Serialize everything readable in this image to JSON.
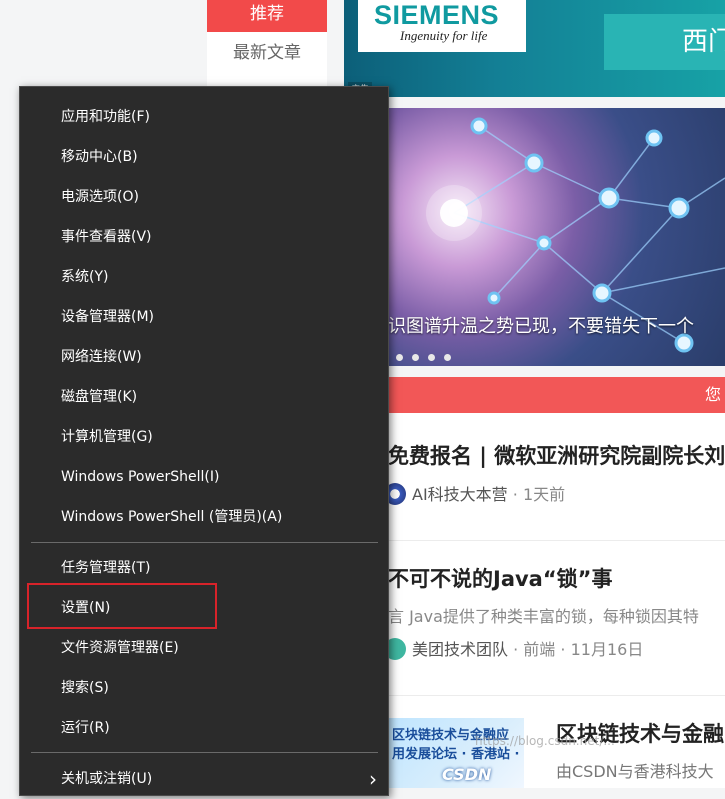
{
  "page": {
    "tab_recommend": "推荐",
    "tab_latest": "最新文章",
    "banner": {
      "brand": "SIEMENS",
      "tagline": "Ingenuity for life",
      "right_text": "西门",
      "ad_tag": "广告"
    },
    "hero": {
      "caption": "识图谱升温之势已现，不要错失下一个",
      "dots": 4
    },
    "red_bar_text": "您",
    "feed": [
      {
        "title": "免费报名 | 微软亚洲研究院副院长刘",
        "author": "AI科技大本营",
        "time": "1天前"
      },
      {
        "title": "不可不说的Java“锁”事",
        "desc": "言 Java提供了种类丰富的锁，每种锁因其特",
        "author": "美团技术团队",
        "category": "前端",
        "time": "11月16日"
      },
      {
        "title": "区块链技术与金融",
        "desc": "由CSDN与香港科技大",
        "thumb_line1": "区块链技术与金融应",
        "thumb_line2": "用发展论坛 · 香港站 ·",
        "thumb_logo": "CSDN"
      }
    ],
    "meta_separator": "·",
    "watermark": "https://blog.csdn.net/..."
  },
  "menu": {
    "items": [
      {
        "label": "应用和功能(F)"
      },
      {
        "label": "移动中心(B)"
      },
      {
        "label": "电源选项(O)"
      },
      {
        "label": "事件查看器(V)"
      },
      {
        "label": "系统(Y)"
      },
      {
        "label": "设备管理器(M)"
      },
      {
        "label": "网络连接(W)"
      },
      {
        "label": "磁盘管理(K)"
      },
      {
        "label": "计算机管理(G)"
      },
      {
        "label": "Windows PowerShell(I)"
      },
      {
        "label": "Windows PowerShell (管理员)(A)"
      },
      {
        "label": "任务管理器(T)"
      },
      {
        "label": "设置(N)",
        "highlighted": true
      },
      {
        "label": "文件资源管理器(E)"
      },
      {
        "label": "搜索(S)"
      },
      {
        "label": "运行(R)"
      },
      {
        "label": "关机或注销(U)",
        "submenu": true
      }
    ],
    "submenu_glyph": "›",
    "highlight_color": "#d8232a"
  }
}
